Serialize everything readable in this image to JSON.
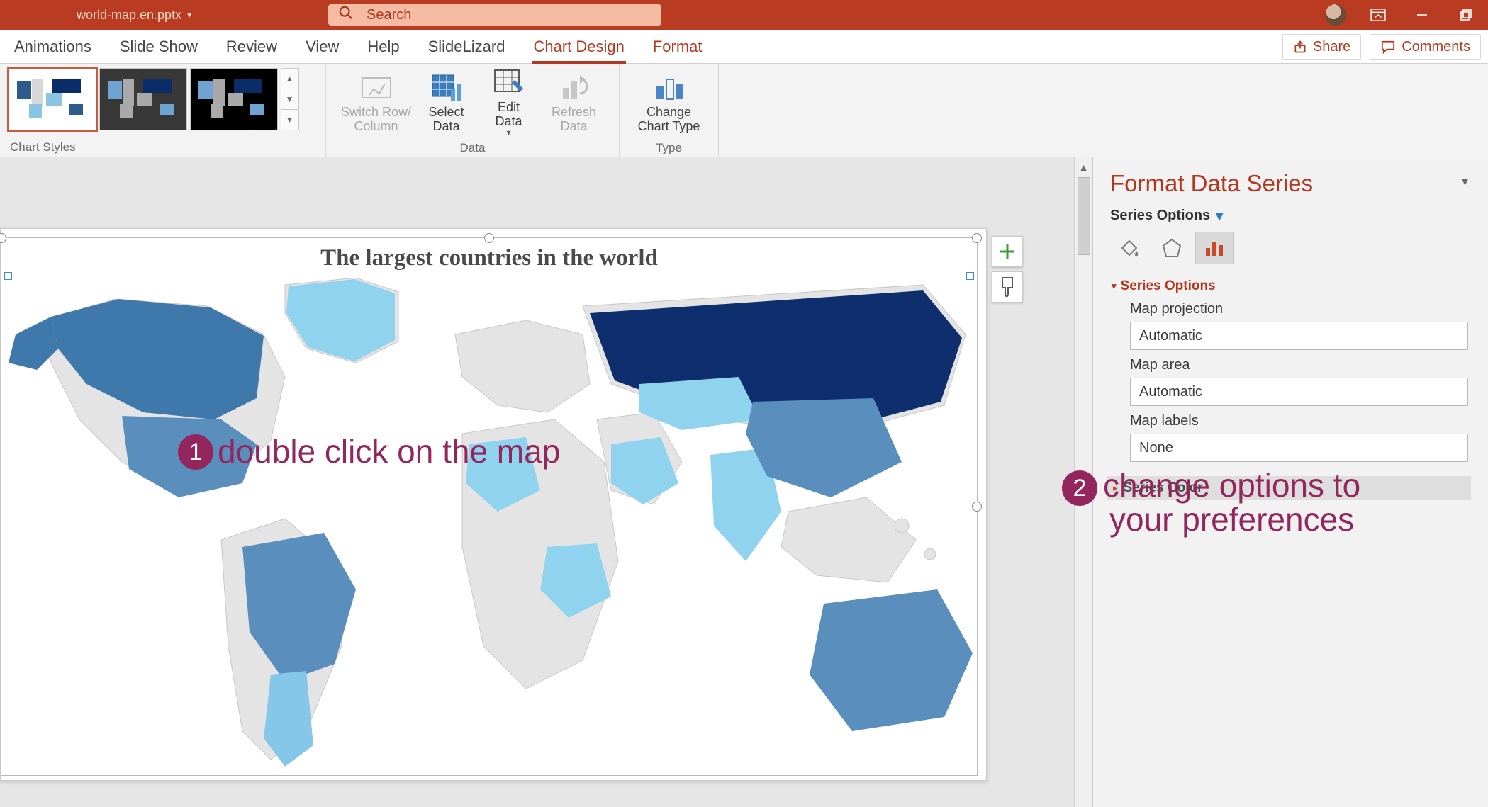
{
  "titlebar": {
    "filename": "world-map.en.pptx",
    "search_placeholder": "Search"
  },
  "tabs": {
    "items": [
      "Animations",
      "Slide Show",
      "Review",
      "View",
      "Help",
      "SlideLizard",
      "Chart Design",
      "Format"
    ],
    "active_index": 6
  },
  "actions": {
    "share": "Share",
    "comments": "Comments"
  },
  "ribbon": {
    "groups": {
      "styles": "Chart Styles",
      "data": "Data",
      "type": "Type"
    },
    "buttons": {
      "switch": "Switch Row/\nColumn",
      "select_data": "Select\nData",
      "edit_data": "Edit\nData",
      "refresh": "Refresh\nData",
      "change_type": "Change\nChart Type"
    }
  },
  "chart": {
    "title": "The largest countries in the world"
  },
  "panel": {
    "title": "Format Data Series",
    "series_options_head": "Series Options",
    "sections": {
      "series_options": "Series Options",
      "series_color": "Series Color"
    },
    "fields": {
      "map_projection": {
        "label": "Map projection",
        "value": "Automatic"
      },
      "map_area": {
        "label": "Map area",
        "value": "Automatic"
      },
      "map_labels": {
        "label": "Map labels",
        "value": "None"
      }
    }
  },
  "annotations": {
    "a1": {
      "num": "1",
      "text": "double click on the map"
    },
    "a2": {
      "num": "2",
      "text": "change options to\nyour preferences"
    }
  }
}
